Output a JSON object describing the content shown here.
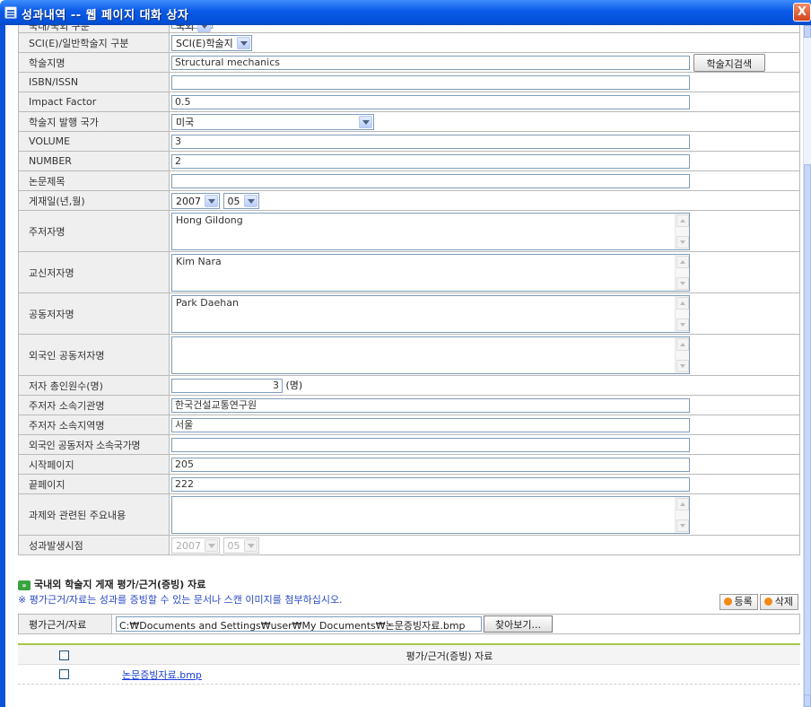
{
  "window": {
    "title": "성과내역 -- 웹 페이지 대화 상자",
    "close_label": "X"
  },
  "form": {
    "partial_top_label": "국내/국외 구분",
    "partial_top_value": "국외",
    "journal_type_label": "SCI(E)/일반학술지 구분",
    "journal_type_value": "SCI(E)학술지",
    "journal_name_label": "학술지명",
    "journal_name_value": "Structural mechanics",
    "journal_search_button": "학술지검색",
    "isbn_label": "ISBN/ISSN",
    "isbn_value": "",
    "impact_label": "Impact Factor",
    "impact_value": "0.5",
    "country_label": "학술지 발행 국가",
    "country_value": "미국",
    "volume_label": "VOLUME",
    "volume_value": "3",
    "number_label": "NUMBER",
    "number_value": "2",
    "title_label": "논문제목",
    "title_value": "",
    "pubdate_label": "게재일(년,월)",
    "pub_year": "2007",
    "pub_month": "05",
    "main_author_label": "주저자명",
    "main_author_value": "Hong Gildong",
    "corr_author_label": "교신저자명",
    "corr_author_value": "Kim Nara",
    "co_author_label": "공동저자명",
    "co_author_value": "Park Daehan",
    "foreign_co_label": "외국인 공동저자명",
    "foreign_co_value": "",
    "total_authors_label": "저자 총인원수(명)",
    "total_authors_value": "3",
    "total_authors_unit": "(명)",
    "main_org_label": "주저자 소속기관명",
    "main_org_value": "한국건설교통연구원",
    "main_region_label": "주저자 소속지역명",
    "main_region_value": "서울",
    "foreign_country_label": "외국인 공동저자 소속국가명",
    "foreign_country_value": "",
    "start_page_label": "시작페이지",
    "start_page_value": "205",
    "end_page_label": "끝페이지",
    "end_page_value": "222",
    "summary_label": "과제와 관련된 주요내용",
    "summary_value": "",
    "occur_label": "성과발생시점",
    "occur_year": "2007",
    "occur_month": "05"
  },
  "attachments": {
    "section_title": "국내외 학술지 게재 평가/근거(증빙) 자료",
    "bullet": "»",
    "notice": "※ 평가근거/자료는 성과를 증빙할 수 있는 문서나 스캔 이미지를 첨부하십시오.",
    "register_button": "등록",
    "delete_button": "삭제",
    "file_label": "평가근거/자료",
    "file_path": "C:₩Documents and Settings₩user₩My Documents₩논문증빙자료.bmp",
    "browse_button": "찾아보기...",
    "list_header": "평가/근거(증빙) 자료",
    "files": [
      "논문증빙자료.bmp"
    ]
  }
}
